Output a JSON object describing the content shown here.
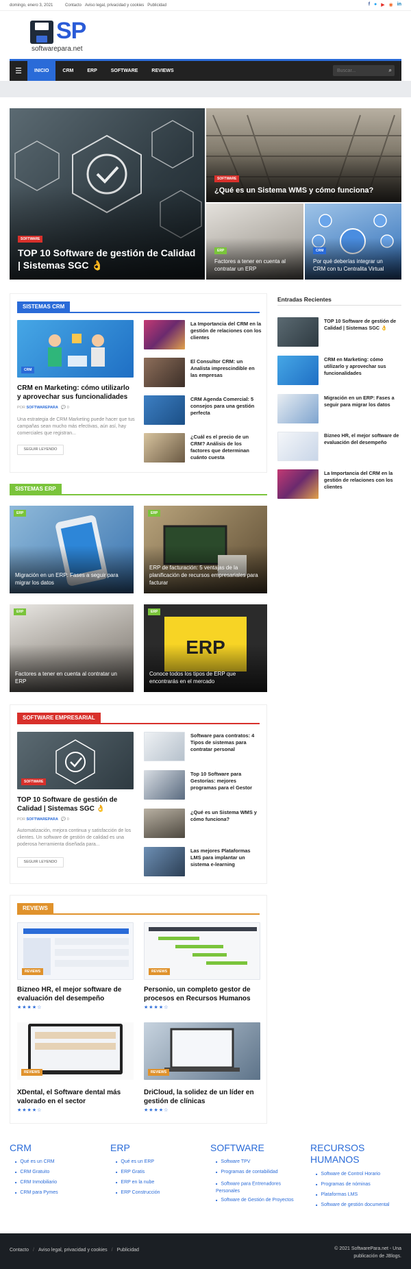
{
  "topbar": {
    "date": "domingo, enero 3, 2021",
    "links": [
      "Contacto",
      "Aviso legal, privacidad y cookies",
      "Publicidad"
    ]
  },
  "logo": {
    "mark": "SP",
    "site": "softwarepara.net"
  },
  "nav": {
    "items": [
      "INICIO",
      "CRM",
      "ERP",
      "SOFTWARE",
      "REVIEWS"
    ],
    "active": "INICIO",
    "search_placeholder": "Buscar..."
  },
  "hero": {
    "main": {
      "badge": "SOFTWARE",
      "title": "TOP 10 Software de gestión de Calidad | Sistemas SGC 👌"
    },
    "top_right": {
      "badge": "SOFTWARE",
      "title": "¿Qué es un Sistema WMS y cómo funciona?"
    },
    "bottom_left": {
      "badge": "ERP",
      "title": "Factores a tener en cuenta al contratar un ERP"
    },
    "bottom_right": {
      "badge": "CRM",
      "title": "Por qué deberías integrar un CRM con tu Centralita Virtual"
    }
  },
  "crm": {
    "heading": "SISTEMAS CRM",
    "featured": {
      "badge": "CRM",
      "title": "CRM en Marketing: cómo utilizarlo y aprovechar sus funcionalidades",
      "by": "POR",
      "author": "SOFTWAREPARA",
      "comments": "0",
      "excerpt": "Una estrategia de CRM Marketing puede hacer que tus campañas sean mucho más efectivas, aún así, hay comerciales que registran...",
      "button": "SEGUIR LEYENDO"
    },
    "list": [
      "La Importancia del CRM en la gestión de relaciones con los clientes",
      "El Consultor CRM: un Analista imprescindible en las empresas",
      "CRM Agenda Comercial: 5 consejos para una gestión perfecta",
      "¿Cuál es el precio de un CRM? Análisis de los factores que determinan cuánto cuesta"
    ]
  },
  "sidebar": {
    "heading": "Entradas Recientes",
    "posts": [
      "TOP 10 Software de gestión de Calidad | Sistemas SGC 👌",
      "CRM en Marketing: cómo utilizarlo y aprovechar sus funcionalidades",
      "Migración en un ERP: Fases a seguir para migrar los datos",
      "Bizneo HR, el mejor software de evaluación del desempeño",
      "La Importancia del CRM en la gestión de relaciones con los clientes"
    ]
  },
  "erp": {
    "heading": "SISTEMAS ERP",
    "badge": "ERP",
    "tiles": [
      "Migración en un ERP: Fases a seguir para migrar los datos",
      "ERP de facturación: 5 ventajas de la planificación de recursos empresariales para facturar",
      "Factores a tener en cuenta al contratar un ERP",
      "Conoce todos los tipos de ERP que encontrarás en el mercado"
    ]
  },
  "software": {
    "heading": "SOFTWARE EMPRESARIAL",
    "featured": {
      "badge": "SOFTWARE",
      "title": "TOP 10 Software de gestión de Calidad | Sistemas SGC 👌",
      "by": "POR",
      "author": "SOFTWAREPARA",
      "comments": "0",
      "excerpt": "Automatización, mejora continua y satisfacción de los clientes. Un software de gestión de calidad es una poderosa herramienta diseñada para...",
      "button": "SEGUIR LEYENDO"
    },
    "list": [
      "Software para contratos: 4 Tipos de sistemas para contratar personal",
      "Top 10 Software para Gestorías: mejores programas para el Gestor",
      "¿Qué es un Sistema WMS y cómo funciona?",
      "Las mejores Plataformas LMS para implantar un sistema e-learning"
    ]
  },
  "reviews": {
    "heading": "REVIEWS",
    "badge": "REVIEWS",
    "stars": "★★★★☆",
    "rating_fraction": 0.9,
    "items": [
      "Bizneo HR, el mejor software de evaluación del desempeño",
      "Personio, un completo gestor de procesos en Recursos Humanos",
      "XDental, el Software dental más valorado en el sector",
      "DriCloud, la solidez de un líder en gestión de clínicas"
    ]
  },
  "footer": {
    "columns": [
      {
        "title": "CRM",
        "links": [
          "Qué es un CRM",
          "CRM Gratuito",
          "CRM Inmobiliario",
          "CRM para Pymes"
        ]
      },
      {
        "title": "ERP",
        "links": [
          "Qué es un ERP",
          "ERP Gratis",
          "ERP en la nube",
          "ERP Construcción"
        ]
      },
      {
        "title": "SOFTWARE",
        "links": [
          "Software TPV",
          "Programas de contabilidad",
          "Software para Entrenadores Personales",
          "Software de Gestión de Proyectos"
        ]
      },
      {
        "title": "RECURSOS HUMANOS",
        "links": [
          "Software de Control Horario",
          "Programas de nóminas",
          "Plataformas LMS",
          "Software de gestión documental"
        ]
      }
    ],
    "bottom_links": [
      "Contacto",
      "Aviso legal, privacidad y cookies",
      "Publicidad"
    ],
    "copyright_1": "© 2021 SoftwarePara.net - Una",
    "copyright_2": "publicación de JBlogs."
  }
}
